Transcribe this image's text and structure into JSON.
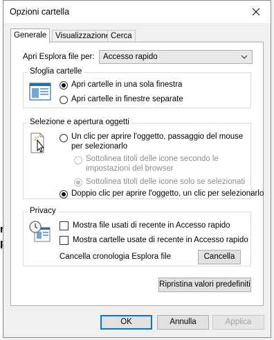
{
  "window": {
    "title": "Opzioni cartella"
  },
  "tabs": [
    {
      "label": "Generale"
    },
    {
      "label": "Visualizzazione"
    },
    {
      "label": "Cerca"
    }
  ],
  "general": {
    "open_label": "Apri Esplora file per:",
    "open_value": "Accesso rapido",
    "browse": {
      "legend": "Sfoglia cartelle",
      "option_same": "Apri cartelle in una sola finestra",
      "option_separate": "Apri cartelle in finestre separate"
    },
    "click": {
      "legend": "Selezione e apertura oggetti",
      "single_line1": "Un clic per aprire l'oggetto, passaggio del mouse",
      "single_line2": "per selezionarlo",
      "underline_browser_line1": "Sottolinea titoli delle icone secondo le",
      "underline_browser_line2": "impostazioni del browser",
      "underline_hover": "Sottolinea titoli delle icone solo se selezionati",
      "double": "Doppio clic per aprire l'oggetto, un clic per selezionarlo"
    },
    "privacy": {
      "legend": "Privacy",
      "recent_files": "Mostra file usati di recente in Accesso rapido",
      "recent_folders": "Mostra cartelle usate di recente in Accesso rapido",
      "clear_label": "Cancella cronologia Esplora file",
      "clear_button": "Cancella"
    },
    "restore_button": "Ripristina valori predefiniti"
  },
  "footer": {
    "ok": "OK",
    "cancel": "Annulla",
    "apply": "Applica"
  },
  "colors": {
    "accent": "#0078d7"
  }
}
